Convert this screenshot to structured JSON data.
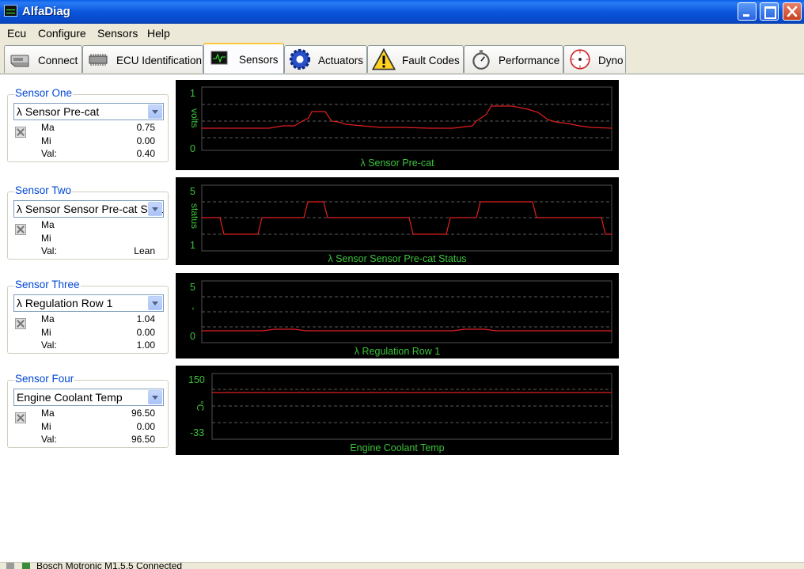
{
  "window": {
    "title": "AlfaDiag"
  },
  "menu": [
    "Ecu",
    "Configure",
    "Sensors",
    "Help"
  ],
  "tabs": [
    {
      "label": "Connect",
      "icon": "connect-icon"
    },
    {
      "label": "ECU Identification",
      "icon": "chip-icon"
    },
    {
      "label": "Sensors",
      "icon": "monitor-icon"
    },
    {
      "label": "Actuators",
      "icon": "gear-icon"
    },
    {
      "label": "Fault Codes",
      "icon": "warning-icon"
    },
    {
      "label": "Performance",
      "icon": "stopwatch-icon"
    },
    {
      "label": "Dyno",
      "icon": "gauge-icon"
    }
  ],
  "sensors": [
    {
      "title": "Sensor One",
      "selected": "λ Sensor Pre-cat",
      "ma_label": "Ma",
      "mi_label": "Mi",
      "val_label": "Val:",
      "ma": "0.75",
      "mi": "0.00",
      "val": "0.40"
    },
    {
      "title": "Sensor Two",
      "selected": "λ Sensor Sensor Pre-cat Status",
      "ma_label": "Ma",
      "mi_label": "Mi",
      "val_label": "Val:",
      "ma": "",
      "mi": "",
      "val": "Lean"
    },
    {
      "title": "Sensor Three",
      "selected": "λ Regulation Row 1",
      "ma_label": "Ma",
      "mi_label": "Mi",
      "val_label": "Val:",
      "ma": "1.04",
      "mi": "0.00",
      "val": "1.00"
    },
    {
      "title": "Sensor Four",
      "selected": "Engine Coolant Temp",
      "ma_label": "Ma",
      "mi_label": "Mi",
      "val_label": "Val:",
      "ma": "96.50",
      "mi": "0.00",
      "val": "96.50"
    }
  ],
  "graphs": [
    {
      "title": "λ Sensor Pre-cat",
      "unit": "volts",
      "ymax": "1",
      "ymid": "",
      "ymin": "0",
      "line_color": "#e02020"
    },
    {
      "title": "λ Sensor Sensor Pre-cat Status",
      "unit": "status",
      "ymax": "5",
      "ymid": "",
      "ymin": "1",
      "line_color": "#e02020"
    },
    {
      "title": "λ Regulation Row 1",
      "unit": "-",
      "ymax": "5",
      "ymid": "",
      "ymin": "0",
      "line_color": "#e02020"
    },
    {
      "title": "Engine Coolant Temp",
      "unit": "°C",
      "ymax": "150",
      "ymid": "",
      "ymin": "-33",
      "line_color": "#e02020"
    }
  ],
  "status": {
    "text": "Bosch Motronic M1.5.5 Connected"
  }
}
